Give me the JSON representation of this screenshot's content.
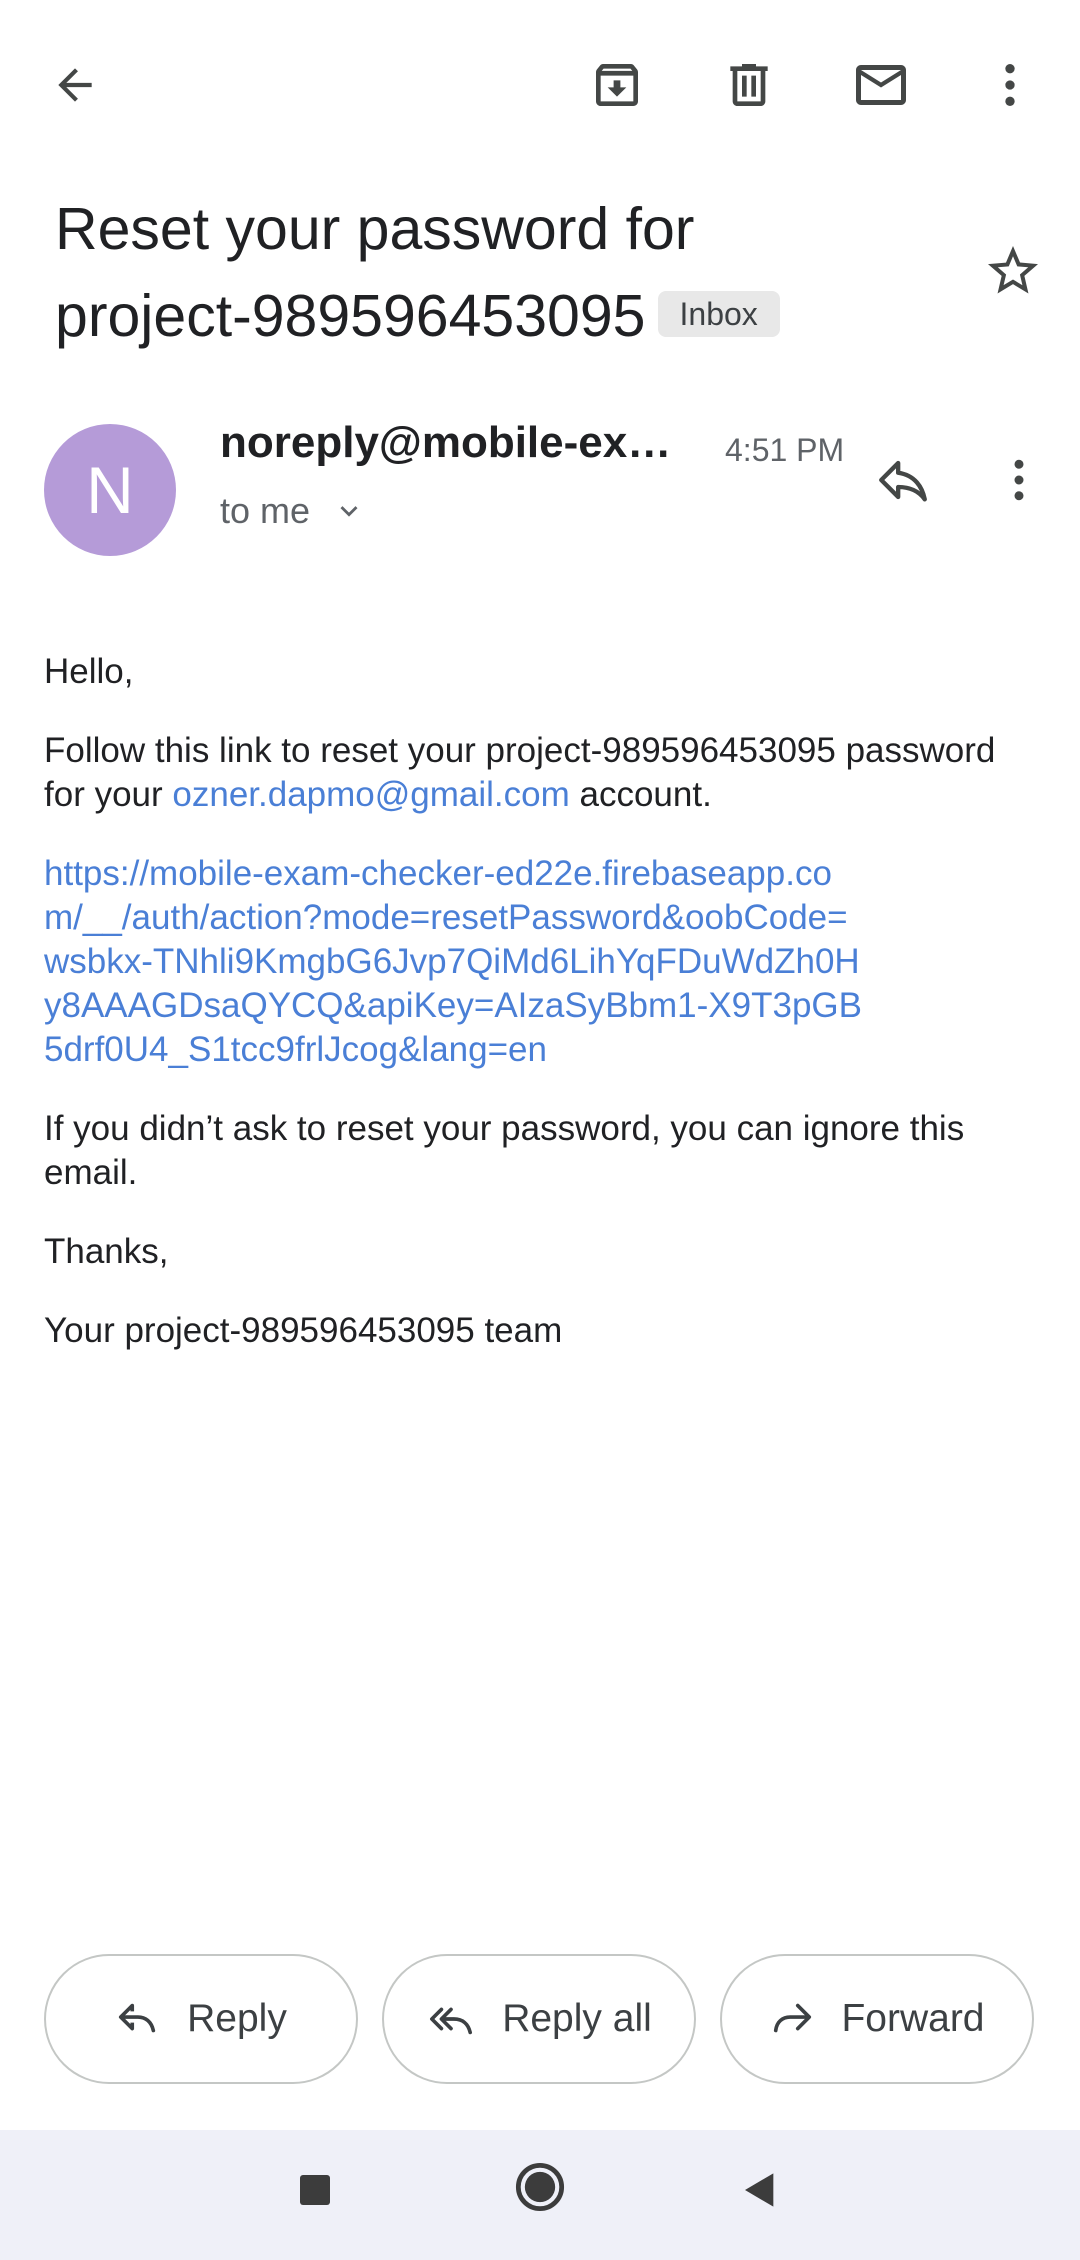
{
  "toolbar": {
    "back_icon": "arrow-back-icon",
    "archive_icon": "archive-icon",
    "delete_icon": "trash-icon",
    "mark_unread_icon": "mail-icon",
    "more_icon": "more-vert-icon"
  },
  "email": {
    "subject_line1": "Reset your password for",
    "subject_line2": "project-989596453095",
    "label": "Inbox",
    "sender_initial": "N",
    "sender": "noreply@mobile-exa...",
    "time": "4:51 PM",
    "recipient": "to me"
  },
  "body": {
    "greeting": "Hello,",
    "intro_before": "Follow this link to reset your project-989596453095 password for your ",
    "intro_email": "ozner.dapmo@gmail.com",
    "intro_after": " account.",
    "reset_url": "https://mobile-exam-checker-ed22e.firebaseapp.com/__/auth/action?mode=resetPassword&oobCode=wsbkx-TNhli9KmgbG6Jvp7QiMd6LihYqFDuWdZh0Hy8AAAGDsaQYCQ&apiKey=AIzaSyBbm1-X9T3pGB5drf0U4_S1tcc9frlJcog&lang=en",
    "ignore_note": "If you didn’t ask to reset your password, you can ignore this email.",
    "thanks": "Thanks,",
    "signature": "Your project-989596453095 team"
  },
  "actions": {
    "reply": "Reply",
    "reply_all": "Reply all",
    "forward": "Forward"
  },
  "colors": {
    "avatar": "#b59bd8",
    "link": "#4a7fd6",
    "navbar": "#eff0f8"
  }
}
